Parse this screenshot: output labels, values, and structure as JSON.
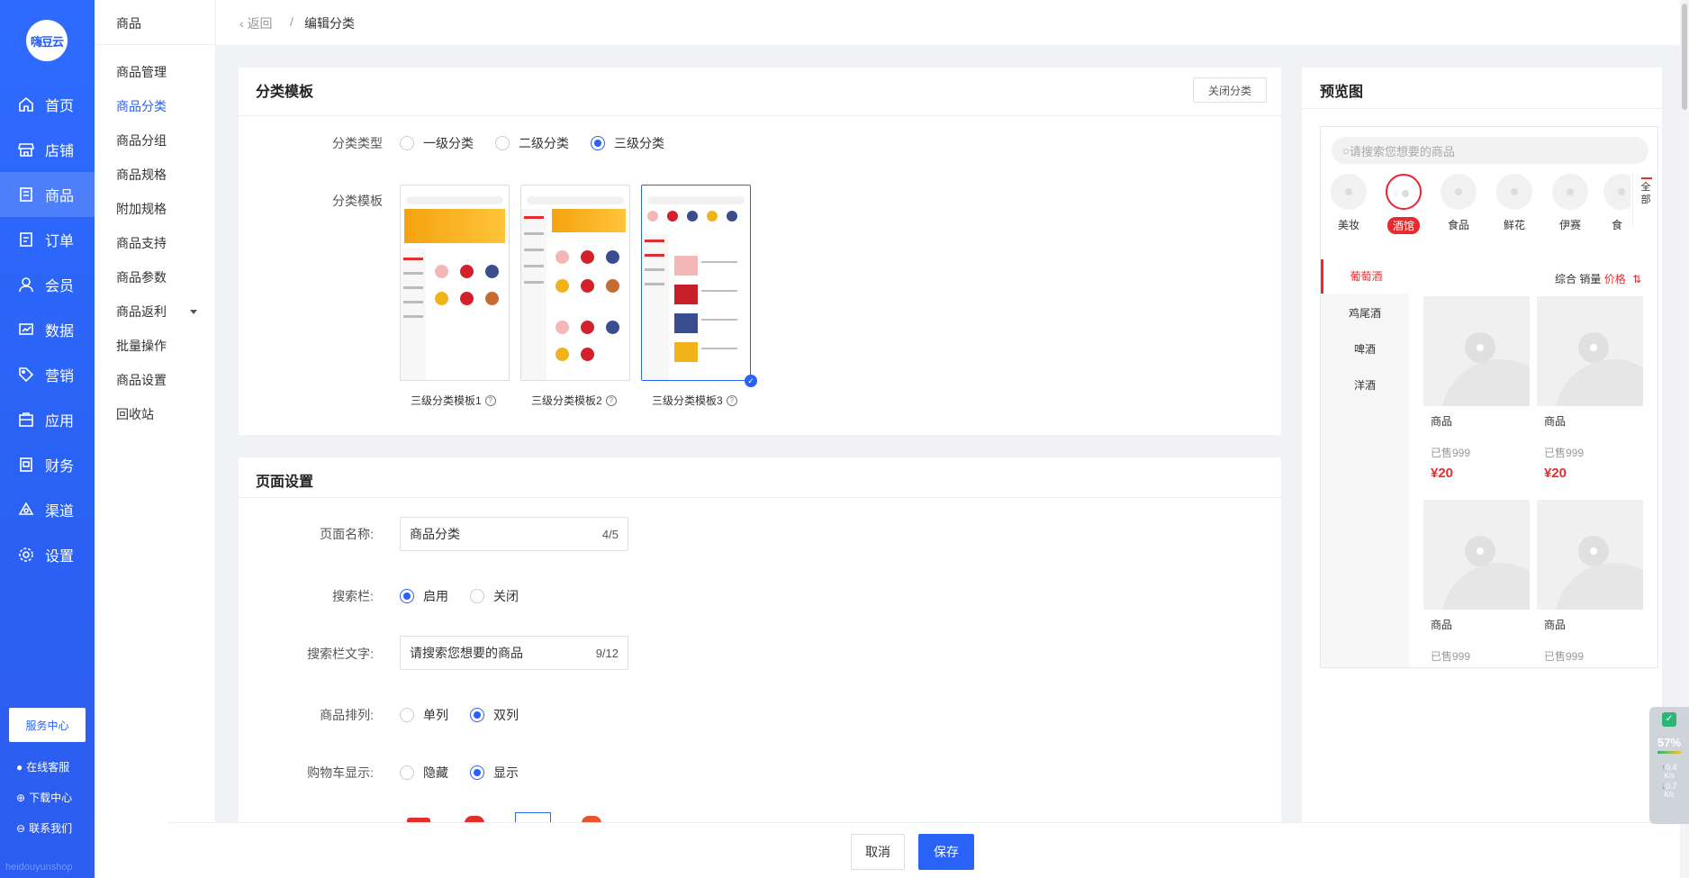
{
  "nav": {
    "logo_text": "嗨豆云",
    "items": [
      {
        "label": "首页",
        "icon": "home-icon"
      },
      {
        "label": "店铺",
        "icon": "store-icon"
      },
      {
        "label": "商品",
        "icon": "goods-icon"
      },
      {
        "label": "订单",
        "icon": "order-icon"
      },
      {
        "label": "会员",
        "icon": "member-icon"
      },
      {
        "label": "数据",
        "icon": "chart-icon"
      },
      {
        "label": "营销",
        "icon": "tag-icon"
      },
      {
        "label": "应用",
        "icon": "app-icon"
      },
      {
        "label": "财务",
        "icon": "finance-icon"
      },
      {
        "label": "渠道",
        "icon": "channel-icon"
      },
      {
        "label": "设置",
        "icon": "gear-icon"
      }
    ],
    "active_index": 2,
    "service_center": "服务中心",
    "online_service": "在线客服",
    "download_center": "下载中心",
    "contact_us": "联系我们",
    "footer_text": "heidouyunshop"
  },
  "subnav": {
    "title": "商品",
    "items": [
      "商品管理",
      "商品分类",
      "商品分组",
      "商品规格",
      "附加规格",
      "商品支持",
      "商品参数",
      "商品返利",
      "批量操作",
      "商品设置",
      "回收站"
    ],
    "active_index": 1
  },
  "breadcrumb": {
    "back": "返回",
    "separator": "/",
    "current": "编辑分类"
  },
  "template_card": {
    "title": "分类模板",
    "close_button": "关闭分类",
    "type_label": "分类类型",
    "type_options": [
      "一级分类",
      "二级分类",
      "三级分类"
    ],
    "type_selected": 2,
    "template_label": "分类模板",
    "templates": [
      "三级分类模板1",
      "三级分类模板2",
      "三级分类模板3"
    ],
    "template_selected": 2
  },
  "page_settings": {
    "title": "页面设置",
    "page_name_label": "页面名称:",
    "page_name_value": "商品分类",
    "page_name_count": "4/5",
    "search_label": "搜索栏:",
    "search_options": [
      "启用",
      "关闭"
    ],
    "search_selected": 0,
    "search_text_label": "搜索栏文字:",
    "search_text_value": "请搜索您想要的商品",
    "search_text_count": "9/12",
    "sort_label": "商品排列:",
    "sort_options": [
      "单列",
      "双列"
    ],
    "sort_selected": 1,
    "cart_label": "购物车显示:",
    "cart_options": [
      "隐藏",
      "显示"
    ],
    "cart_selected": 1
  },
  "preview": {
    "title": "预览图",
    "search_placeholder": "请搜索您想要的商品",
    "categories": [
      "美妆",
      "酒馆",
      "食品",
      "鲜花",
      "伊赛",
      "食"
    ],
    "category_selected": 1,
    "all_label": "全部",
    "side_items": [
      "葡萄酒",
      "鸡尾酒",
      "啤酒",
      "洋酒"
    ],
    "side_selected": 0,
    "sort_tabs": [
      "综合",
      "销量",
      "价格"
    ],
    "goods": [
      {
        "name": "商品",
        "sold": "已售999",
        "price": "¥20"
      },
      {
        "name": "商品",
        "sold": "已售999",
        "price": "¥20"
      },
      {
        "name": "商品",
        "sold": "已售999",
        "price": ""
      },
      {
        "name": "商品",
        "sold": "已售999",
        "price": ""
      }
    ]
  },
  "footer": {
    "cancel": "取消",
    "save": "保存"
  },
  "monitor": {
    "percent": "57%",
    "up": "0.4",
    "up_unit": "K/s",
    "down": "0.7",
    "down_unit": "K/s"
  },
  "colors": {
    "primary": "#2a62f5",
    "accent_red": "#e62d2d"
  }
}
